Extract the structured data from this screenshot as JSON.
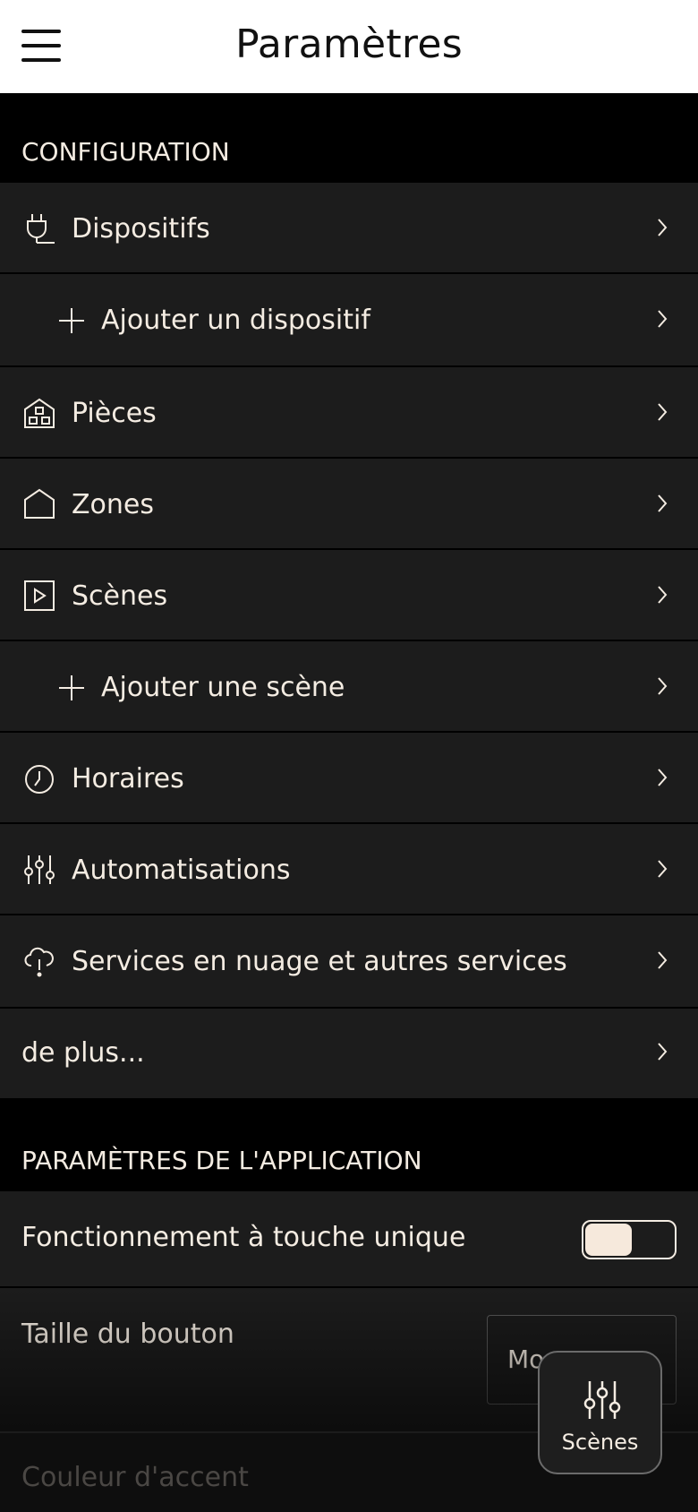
{
  "header": {
    "title": "Paramètres",
    "menu_icon": "hamburger-menu-icon"
  },
  "sections": {
    "configuration": "CONFIGURATION",
    "app_settings": "PARAMÈTRES DE L'APPLICATION"
  },
  "config_items": [
    {
      "label": "Dispositifs",
      "icon": "plug-icon"
    },
    {
      "label": "Ajouter un dispositif",
      "icon": "plus-icon"
    },
    {
      "label": "Pièces",
      "icon": "rooms-house-icon"
    },
    {
      "label": "Zones",
      "icon": "zone-house-icon"
    },
    {
      "label": "Scènes",
      "icon": "play-square-icon"
    },
    {
      "label": "Ajouter une scène",
      "icon": "plus-icon"
    },
    {
      "label": "Horaires",
      "icon": "clock-icon"
    },
    {
      "label": "Automatisations",
      "icon": "sliders-icon"
    },
    {
      "label": "Services en nuage et autres services",
      "icon": "cloud-icon"
    },
    {
      "label": "de plus..."
    }
  ],
  "app_settings": {
    "single_touch": {
      "label": "Fonctionnement à touche unique",
      "enabled": false
    },
    "button_size": {
      "label": "Taille du bouton",
      "value": "Mo"
    },
    "accent_color": {
      "label": "Couleur d'accent"
    }
  },
  "fab": {
    "label": "Scènes",
    "icon": "sliders-icon"
  },
  "colors": {
    "background": "#000000",
    "row": "#1c1c1c",
    "text": "#f4ece2",
    "header_bg": "#ffffff"
  }
}
